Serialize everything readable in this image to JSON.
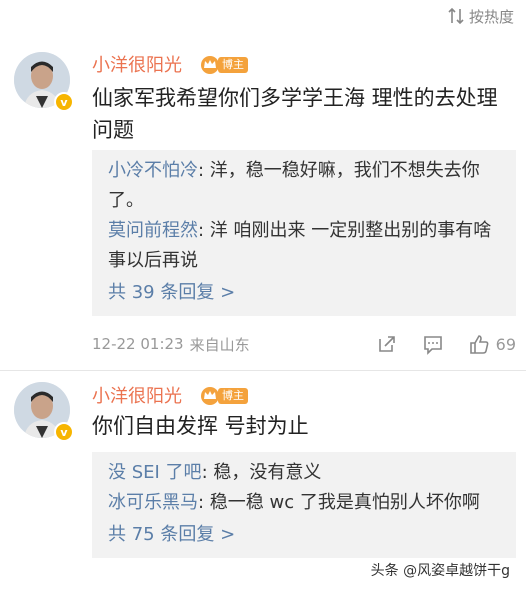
{
  "sort": {
    "label": "按热度"
  },
  "comments": [
    {
      "username": "小洋很阳光",
      "badge": "博主",
      "text": "仙家军我希望你们多学学王海 理性的去处理问题",
      "replies": [
        {
          "name": "小冷不怕冷",
          "text": "洋，稳一稳好嘛，我们不想失去你了。"
        },
        {
          "name": "莫问前程然",
          "text": "洋  咱刚出来  一定别整出别的事有啥事以后再说"
        }
      ],
      "more_replies": "共 39 条回复 >",
      "time": "12-22 01:23",
      "source": "来自山东",
      "likes": "69"
    },
    {
      "username": "小洋很阳光",
      "badge": "博主",
      "text": "你们自由发挥 号封为止",
      "replies": [
        {
          "name": "没 SEI 了吧",
          "text": "稳，没有意义"
        },
        {
          "name": "冰可乐黑马",
          "text": "稳一稳 wc 了我是真怕别人坏你啊"
        }
      ],
      "more_replies": "共 75 条回复 >"
    }
  ],
  "watermark": "头条 @风姿卓越饼干g",
  "colors": {
    "username": "#eb7350",
    "reply_name": "#5b7ea8",
    "badge": "#f4a23c",
    "verified": "#f7b500"
  }
}
